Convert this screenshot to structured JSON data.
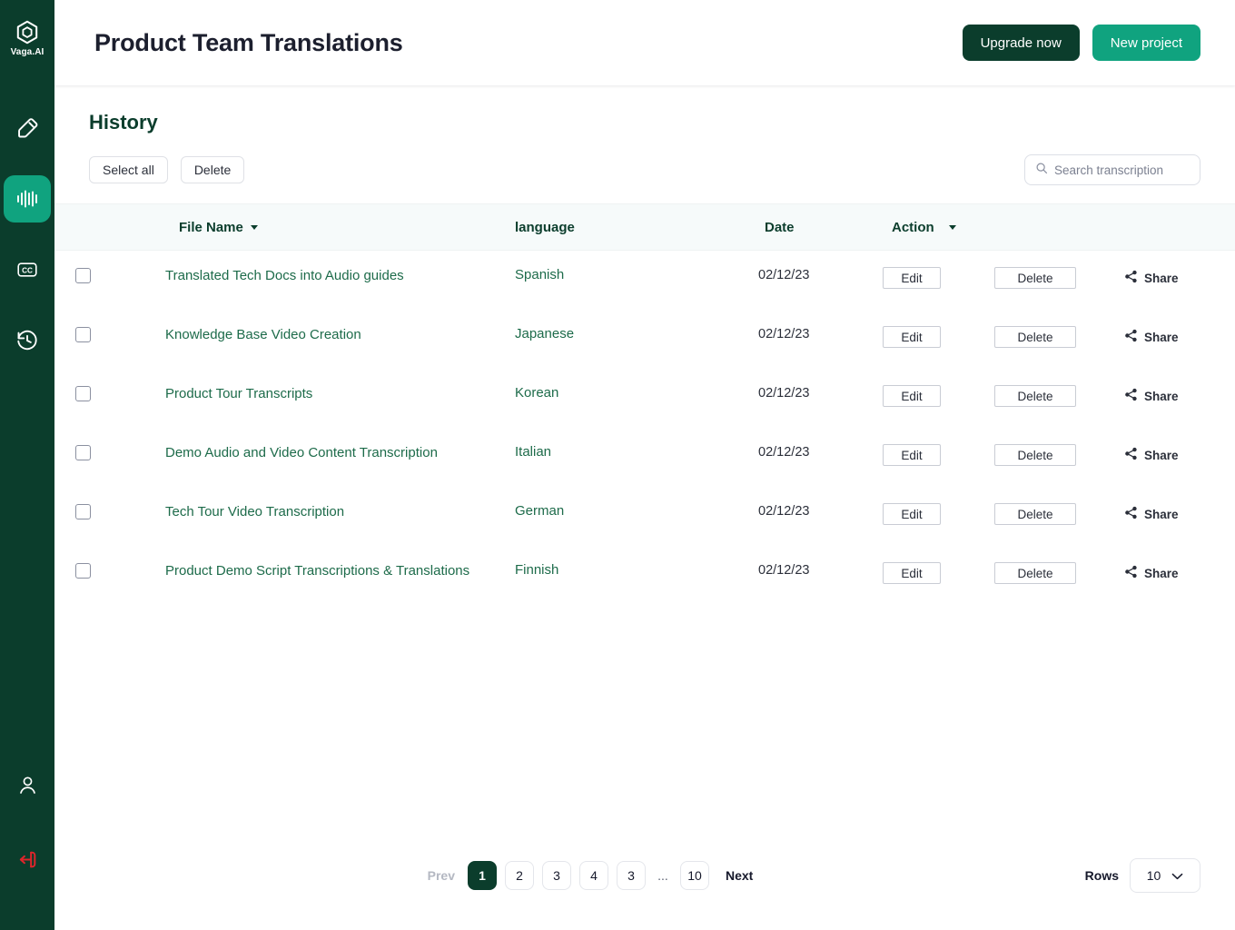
{
  "sidebar": {
    "logo": {
      "icon": "hexagon-logo-icon",
      "text": "Vaga.AI"
    },
    "items": [
      {
        "icon": "edit-pencil-icon",
        "name": "edit",
        "active": false
      },
      {
        "icon": "audio-waveform-icon",
        "name": "transcribe",
        "active": true
      },
      {
        "icon": "closed-caption-icon",
        "name": "captions",
        "active": false
      },
      {
        "icon": "history-clock-icon",
        "name": "history",
        "active": false
      }
    ],
    "bottom": [
      {
        "icon": "user-profile-icon",
        "name": "profile"
      },
      {
        "icon": "logout-icon",
        "name": "logout"
      }
    ]
  },
  "header": {
    "title": "Product Team Translations",
    "upgrade_label": "Upgrade now",
    "new_project_label": "New project"
  },
  "history": {
    "title": "History",
    "select_all_label": "Select all",
    "delete_label": "Delete",
    "search": {
      "placeholder": "Search transcription",
      "value": "",
      "icon": "search-icon"
    }
  },
  "table": {
    "columns": [
      {
        "label": "File Name",
        "sortable": true
      },
      {
        "label": "language",
        "sortable": false
      },
      {
        "label": "Date",
        "sortable": false
      },
      {
        "label": "Action",
        "sortable": true
      }
    ],
    "action_labels": {
      "edit": "Edit",
      "delete": "Delete",
      "share": "Share"
    },
    "rows": [
      {
        "name": "Translated Tech Docs into Audio guides",
        "language": "Spanish",
        "date": "02/12/23"
      },
      {
        "name": "Knowledge Base Video Creation",
        "language": "Japanese",
        "date": "02/12/23"
      },
      {
        "name": "Product Tour Transcripts",
        "language": "Korean",
        "date": "02/12/23"
      },
      {
        "name": "Demo Audio and Video Content Transcription",
        "language": "Italian",
        "date": "02/12/23"
      },
      {
        "name": "Tech Tour Video Transcription",
        "language": "German",
        "date": "02/12/23"
      },
      {
        "name": "Product Demo Script Transcriptions & Translations",
        "language": "Finnish",
        "date": "02/12/23"
      }
    ]
  },
  "pagination": {
    "prev_label": "Prev",
    "next_label": "Next",
    "pages": [
      "1",
      "2",
      "3",
      "4",
      "3",
      "...",
      "10"
    ],
    "current_page": "1",
    "rows_label": "Rows",
    "rows_value": "10"
  },
  "colors": {
    "sidebar_bg": "#0b3d2c",
    "accent_green": "#10a37f",
    "dark_green": "#0b3d2c",
    "link_green": "#1d6b4a",
    "logout_red": "#e0252b",
    "header_band": "#f6fafa"
  }
}
